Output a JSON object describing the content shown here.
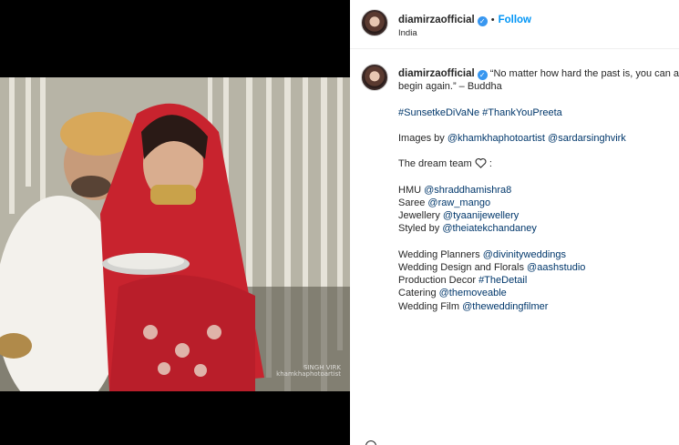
{
  "post": {
    "username": "diamirzaofficial",
    "follow_label": "Follow",
    "location": "India",
    "separator": "•",
    "verified_mark": "✓"
  },
  "caption": {
    "username": "diamirzaofficial",
    "quote_line1": "“No matter how hard the past is, you can al",
    "quote_line2": "begin again.” – Buddha",
    "hashtags": [
      "#SunsetkeDiVaNe",
      "#ThankYouPreeta"
    ],
    "images_by_prefix": "Images by",
    "images_by": [
      "@khamkhaphotoartist",
      "@sardarsinghvirk"
    ],
    "dream_team": "The dream team",
    "dream_team_suffix": ":",
    "credits": [
      {
        "label": "HMU",
        "handle": "@shraddhamishra8"
      },
      {
        "label": "Saree",
        "handle": "@raw_mango"
      },
      {
        "label": "Jewellery",
        "handle": "@tyaanijewellery"
      },
      {
        "label": "Styled by",
        "handle": "@theiatekchandaney"
      }
    ],
    "credits2": [
      {
        "label": "Wedding Planners",
        "handle": "@divinityweddings"
      },
      {
        "label": "Wedding Design and Florals",
        "handle": "@aashstudio"
      },
      {
        "label": "Production Decor",
        "handle": "#TheDetail"
      },
      {
        "label": "Catering",
        "handle": "@themoveable"
      },
      {
        "label": "Wedding Film",
        "handle": "@theweddingfilmer"
      }
    ]
  },
  "media": {
    "watermark_line1": "SINGH VIRK",
    "watermark_line2": "khamkhaphotoartist"
  },
  "icons": {
    "heart": "heart-icon",
    "verified": "verified-badge-icon"
  },
  "colors": {
    "link": "#00376b",
    "follow": "#0095f6",
    "verified": "#3897f0",
    "media_background": "#000000"
  }
}
